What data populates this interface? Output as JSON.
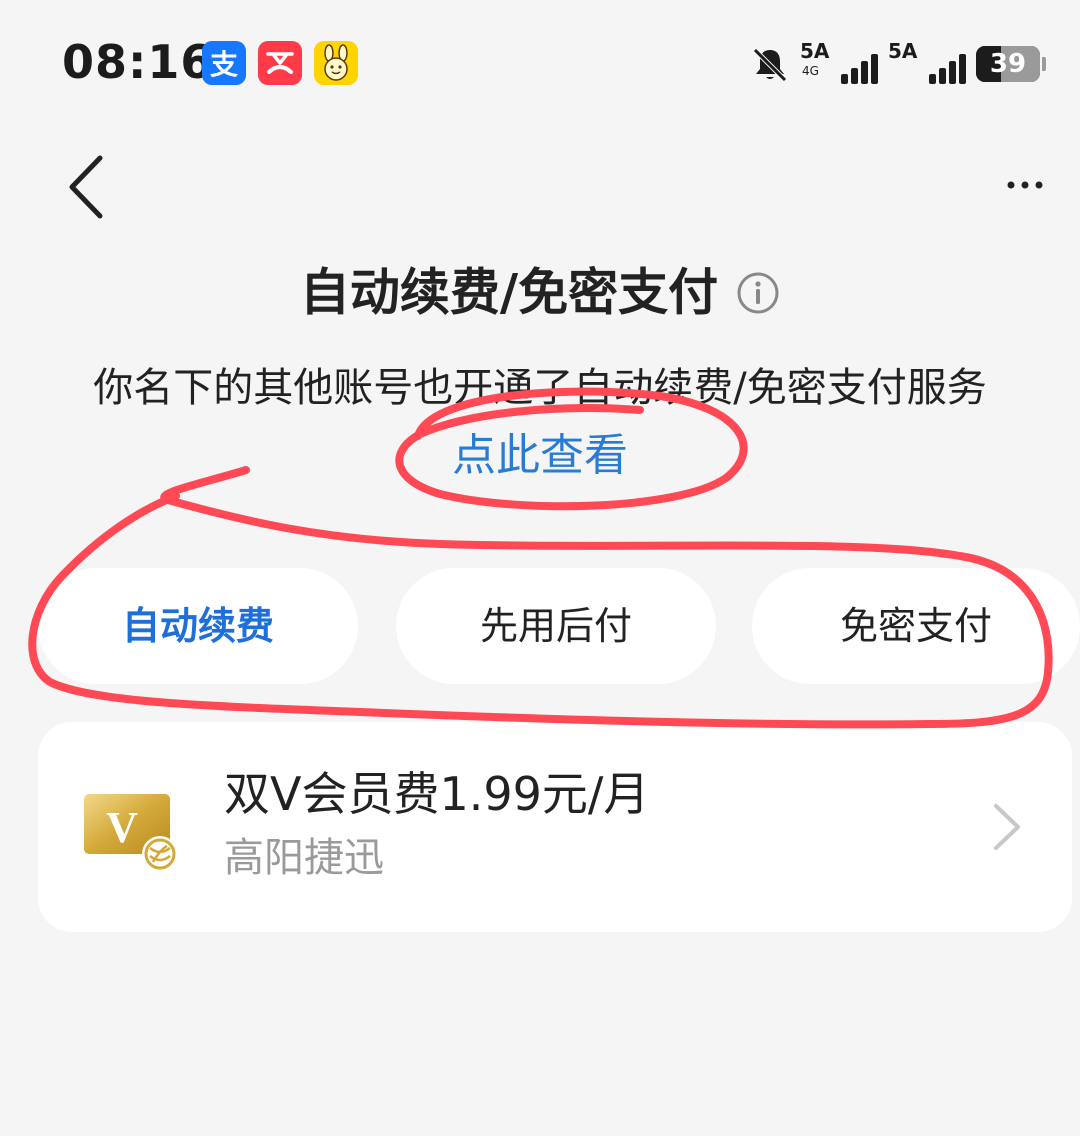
{
  "status_bar": {
    "time": "08:16",
    "app_icons": [
      {
        "name": "alipay-icon",
        "glyph": "支",
        "color": "#1677ff"
      },
      {
        "name": "phone-icon",
        "glyph": "✆",
        "color": "#ff3b4a"
      },
      {
        "name": "mascot-icon",
        "glyph": "ᴗ",
        "color": "#ffd400"
      }
    ],
    "signal_1": {
      "network": "5A",
      "sub": "4G"
    },
    "signal_2": {
      "network": "5A"
    },
    "battery_level": "39",
    "icons": [
      "bell-muted-icon",
      "signal-icon",
      "battery-icon"
    ]
  },
  "nav": {
    "back_icon": "chevron-left-icon",
    "more_icon": "more-icon",
    "more_glyph": "···"
  },
  "page": {
    "title": "自动续费/免密支付",
    "info_icon": "info-icon",
    "notice": "你名下的其他账号也开通了自动续费/免密支付服务",
    "notice_link": "点此查看"
  },
  "tabs": [
    {
      "label": "自动续费",
      "active": true
    },
    {
      "label": "先用后付",
      "active": false
    },
    {
      "label": "免密支付",
      "active": false
    }
  ],
  "items": [
    {
      "title": "双V会员费1.99元/月",
      "subtitle": "高阳捷迅",
      "icon": "vip-card-icon",
      "icon_glyph": "V"
    }
  ],
  "colors": {
    "background": "#f5f5f5",
    "card": "#ffffff",
    "accent_blue": "#1e6fd9",
    "link_blue": "#2a7bd4",
    "annotation_red": "#ff4a55",
    "vip_gold": "#d4a93a"
  }
}
